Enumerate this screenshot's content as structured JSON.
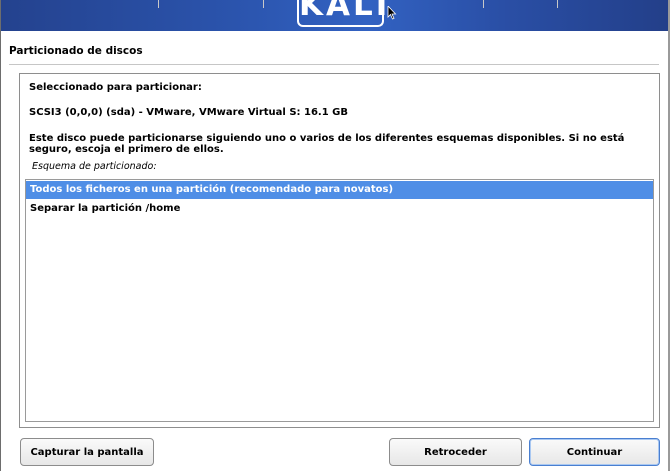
{
  "banner": {
    "logo_text": "KALI"
  },
  "page": {
    "title": "Particionado de discos"
  },
  "content": {
    "selected_label": "Seleccionado para particionar:",
    "disk": "SCSI3 (0,0,0) (sda) - VMware, VMware Virtual S: 16.1 GB",
    "description": "Este disco puede particionarse siguiendo uno o varios de los diferentes esquemas disponibles. Si no está seguro, escoja el primero de ellos.",
    "scheme_label": "Esquema de particionado:"
  },
  "list": {
    "items": [
      {
        "label": "Todos los ficheros en una partición (recomendado para novatos)",
        "selected": true
      },
      {
        "label": "Separar la partición /home",
        "selected": false
      }
    ]
  },
  "buttons": {
    "screenshot": "Capturar la pantalla",
    "back": "Retroceder",
    "continue": "Continuar"
  },
  "colors": {
    "banner": "#2b54ad",
    "selection": "#4f8ee6"
  },
  "icons": {
    "cursor": "mouse-pointer-icon"
  }
}
